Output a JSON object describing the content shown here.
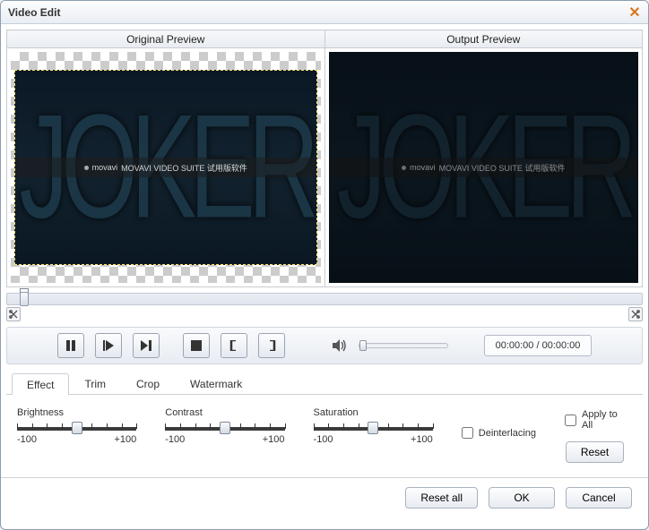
{
  "window": {
    "title": "Video Edit"
  },
  "preview": {
    "original_label": "Original Preview",
    "output_label": "Output Preview",
    "frame_text": "JOKER",
    "watermark_brand": "movavi",
    "watermark_suffix": "MOVAVI VIDEO SUITE 试用版软件"
  },
  "transport": {
    "time_current": "00:00:00",
    "time_total": "00:00:00"
  },
  "tabs": {
    "items": [
      "Effect",
      "Trim",
      "Crop",
      "Watermark"
    ],
    "active_index": 0
  },
  "effect": {
    "sliders": [
      {
        "label": "Brightness",
        "min": "-100",
        "max": "+100",
        "value": 0
      },
      {
        "label": "Contrast",
        "min": "-100",
        "max": "+100",
        "value": 0
      },
      {
        "label": "Saturation",
        "min": "-100",
        "max": "+100",
        "value": 0
      }
    ],
    "deinterlacing_label": "Deinterlacing",
    "apply_all_label": "Apply to All",
    "reset_label": "Reset"
  },
  "footer": {
    "reset_all": "Reset all",
    "ok": "OK",
    "cancel": "Cancel"
  }
}
